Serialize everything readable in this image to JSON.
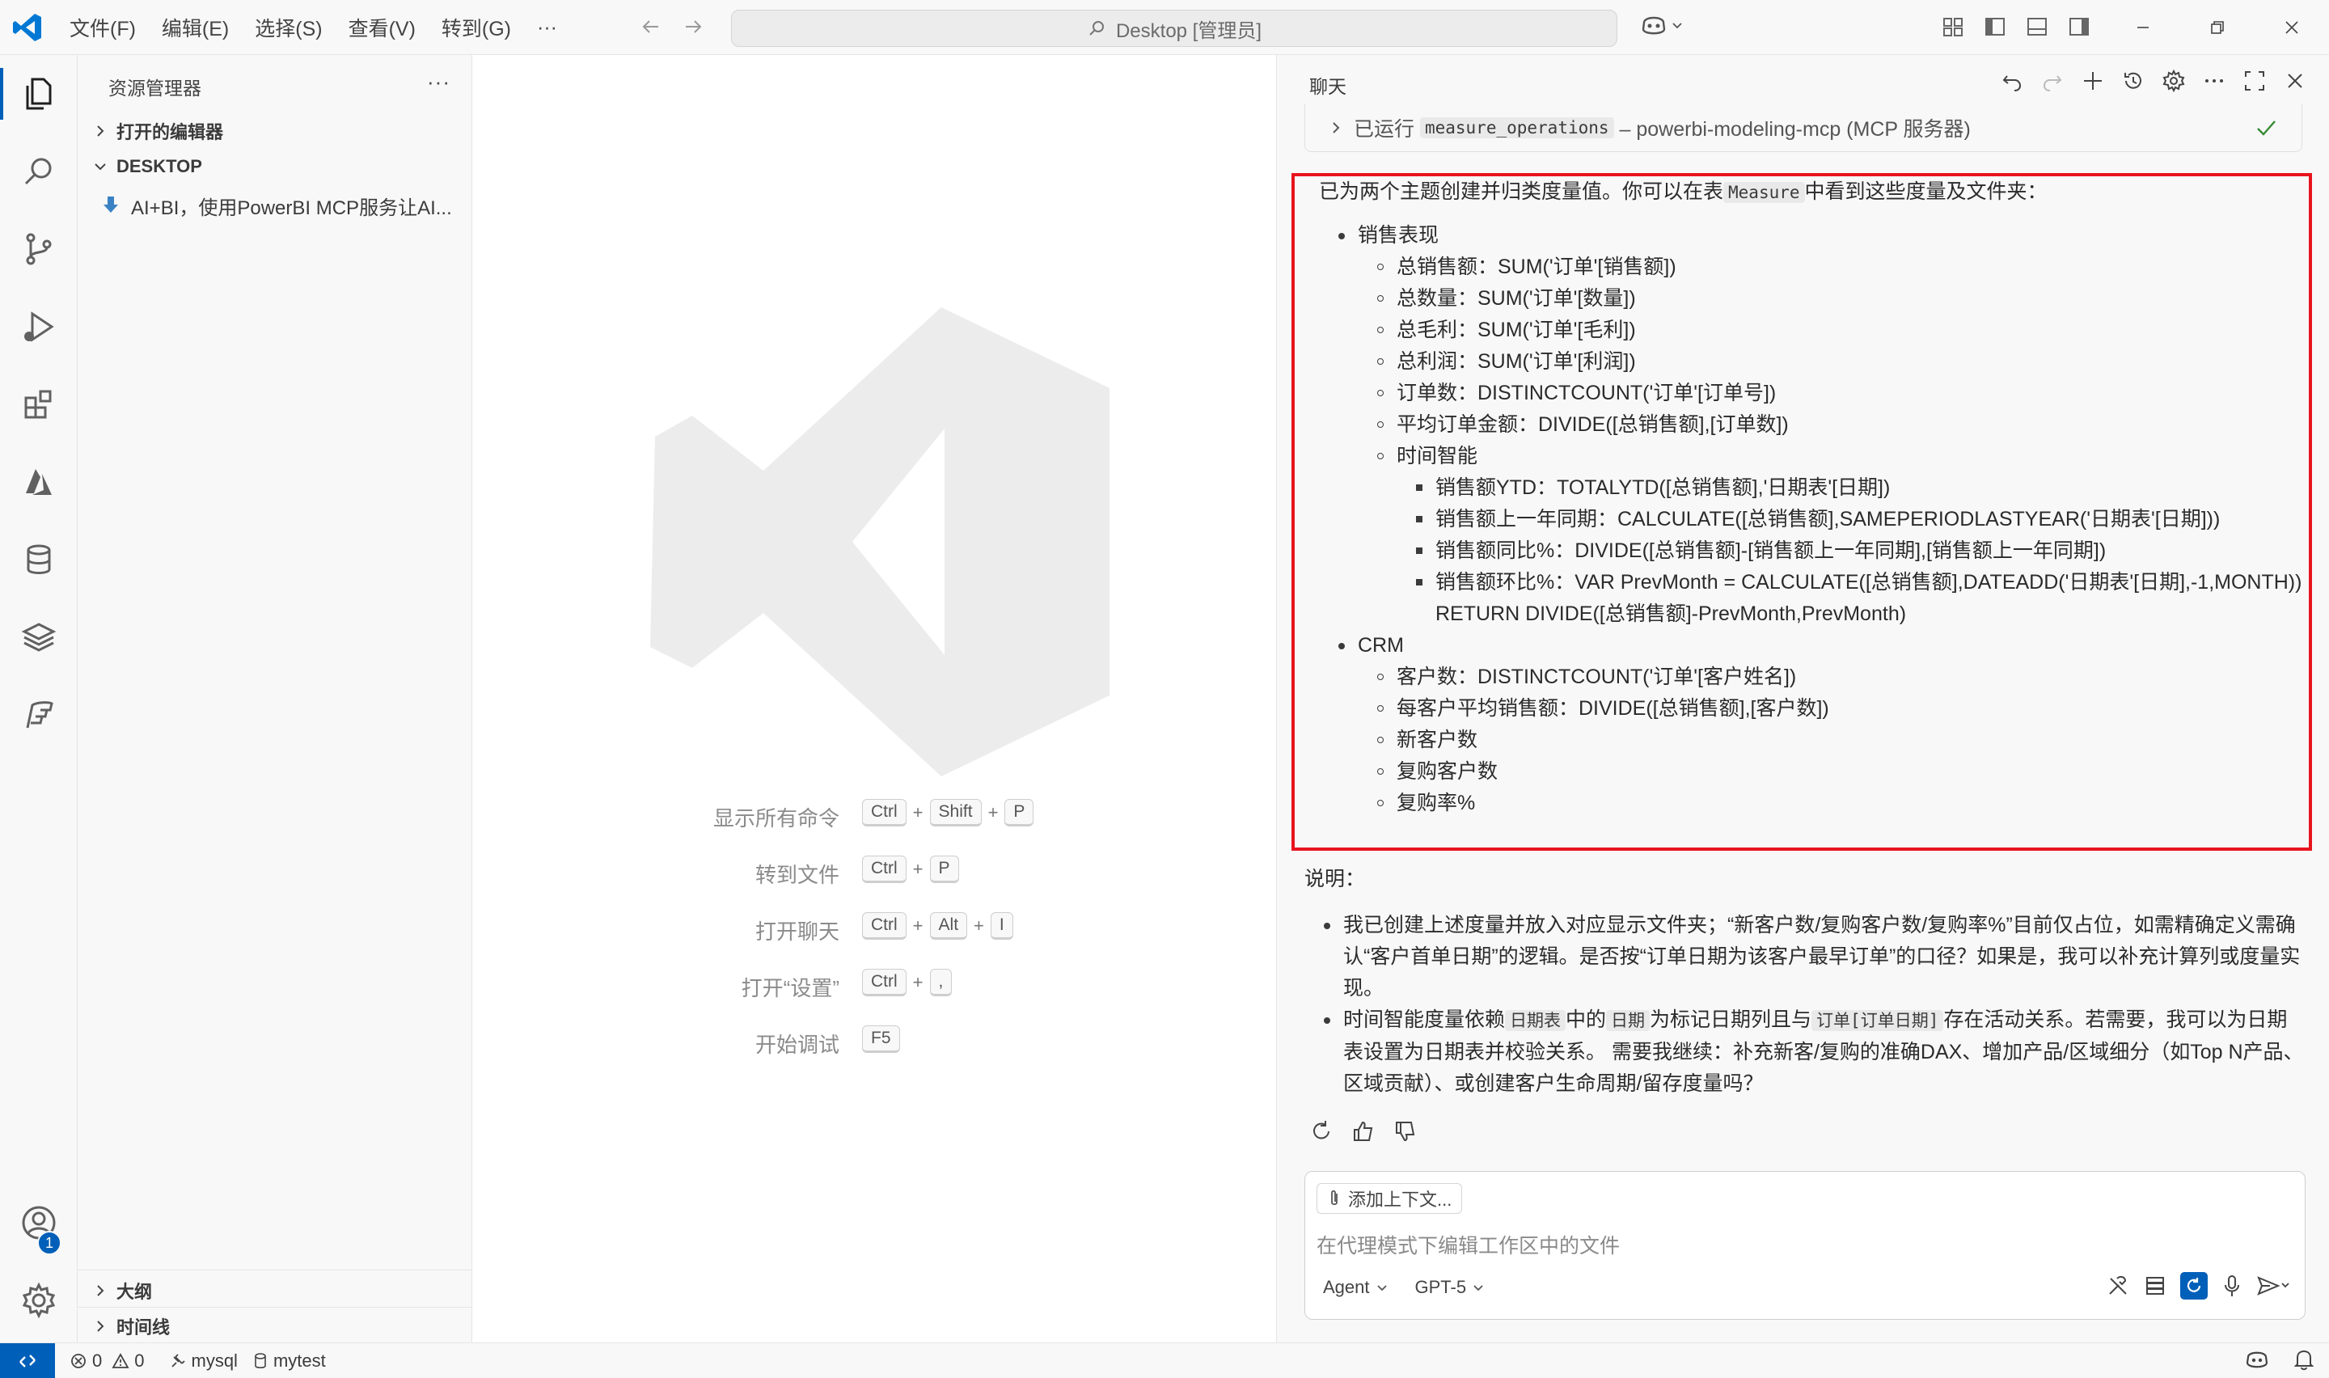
{
  "titlebar": {
    "menu": [
      "文件(F)",
      "编辑(E)",
      "选择(S)",
      "查看(V)",
      "转到(G)",
      "···"
    ],
    "search": "Desktop [管理员]"
  },
  "sidebar": {
    "title": "资源管理器",
    "more": "···",
    "open_editors": "打开的编辑器",
    "folder": "DESKTOP",
    "file": "AI+BI，使用PowerBI MCP服务让AI...",
    "outline": "大纲",
    "timeline": "时间线"
  },
  "activity": {
    "accounts_badge": "1"
  },
  "editor": {
    "shortcuts": [
      {
        "label": "显示所有命令",
        "keys": [
          "Ctrl",
          "Shift",
          "P"
        ]
      },
      {
        "label": "转到文件",
        "keys": [
          "Ctrl",
          "P"
        ]
      },
      {
        "label": "打开聊天",
        "keys": [
          "Ctrl",
          "Alt",
          "I"
        ]
      },
      {
        "label": "打开“设置”",
        "keys": [
          "Ctrl",
          ","
        ]
      },
      {
        "label": "开始调试",
        "keys": [
          "F5"
        ]
      }
    ]
  },
  "chat": {
    "tab": "聊天",
    "tool_run": {
      "prefix": "已运行",
      "tool": "measure_operations",
      "suffix": "– powerbi-modeling-mcp (MCP 服务器)"
    },
    "intro": {
      "before": "已为两个主题创建并归类度量值。你可以在表",
      "table": "Measure",
      "after": "中看到这些度量及文件夹："
    },
    "sales": {
      "title": "销售表现",
      "items": [
        "总销售额：SUM('订单'[销售额])",
        "总数量：SUM('订单'[数量])",
        "总毛利：SUM('订单'[毛利])",
        "总利润：SUM('订单'[利润])",
        "订单数：DISTINCTCOUNT('订单'[订单号])",
        "平均订单金额：DIVIDE([总销售额],[订单数])"
      ],
      "time_intel": "时间智能",
      "time_items": [
        "销售额YTD：TOTALYTD([总销售额],'日期表'[日期])",
        "销售额上一年同期：CALCULATE([总销售额],SAMEPERIODLASTYEAR('日期表'[日期]))",
        "销售额同比%：DIVIDE([总销售额]-[销售额上一年同期],[销售额上一年同期])",
        "销售额环比%：VAR PrevMonth = CALCULATE([总销售额],DATEADD('日期表'[日期],-1,MONTH))",
        "RETURN DIVIDE([总销售额]-PrevMonth,PrevMonth)"
      ]
    },
    "crm": {
      "title": "CRM",
      "items": [
        "客户数：DISTINCTCOUNT('订单'[客户姓名])",
        "每客户平均销售额：DIVIDE([总销售额],[客户数])",
        "新客户数",
        "复购客户数",
        "复购率%"
      ]
    },
    "notes_title": "说明：",
    "note1": "我已创建上述度量并放入对应显示文件夹；“新客户数/复购客户数/复购率%”目前仅占位，如需精确定义需确认“客户首单日期”的逻辑。是否按“订单日期为该客户最早订单”的口径？如果是，我可以补充计算列或度量实现。",
    "note2": {
      "a": "时间智能度量依赖",
      "code1": "日期表",
      "b": "中的",
      "code2": "日期",
      "c": "为标记日期列且与",
      "code3": "订单[订单日期]",
      "d": "存在活动关系。若需要，我可以为日期表设置为日期表并校验关系。 需要我继续：补充新客/复购的准确DAX、增加产品/区域细分（如Top N产品、区域贡献）、或创建客户生命周期/留存度量吗？"
    },
    "input": {
      "add_context": "添加上下文...",
      "placeholder": "在代理模式下编辑工作区中的文件",
      "mode": "Agent",
      "model": "GPT-5"
    }
  },
  "status": {
    "errors": "0",
    "warnings": "0",
    "db": "mysql",
    "schema": "mytest"
  },
  "colors": {
    "accent": "#005fb8",
    "highlight_border": "#e8141e"
  }
}
